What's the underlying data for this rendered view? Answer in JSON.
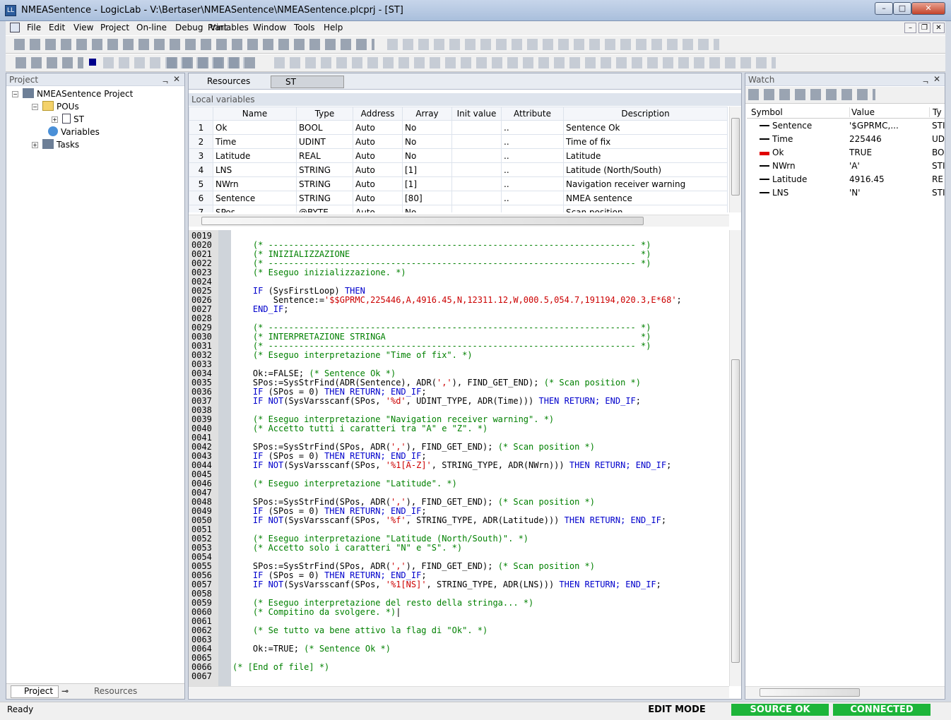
{
  "window": {
    "title": "NMEASentence - LogicLab - V:\\Bertaser\\NMEASentence\\NMEASentence.plcprj - [ST]",
    "icon": "logiclab-app-icon",
    "min": "–",
    "max": "□",
    "close": "✕"
  },
  "menu": [
    "File",
    "Edit",
    "View",
    "Project",
    "On-line",
    "Debug",
    "Print",
    "Variables",
    "Window",
    "Tools",
    "Help"
  ],
  "project_panel": {
    "title": "Project",
    "pin": "ᆨ",
    "close": "✕",
    "tree": {
      "root": "NMEASentence Project",
      "pous": "POUs",
      "st": "ST",
      "variables": "Variables",
      "tasks": "Tasks"
    },
    "tabs": [
      "Project",
      "",
      "Resources"
    ]
  },
  "editor_tabs": [
    "Resources",
    "ST"
  ],
  "locals": {
    "title": "Local variables",
    "columns": [
      "Name",
      "Type",
      "Address",
      "Array",
      "Init value",
      "Attribute",
      "Description"
    ],
    "rows": [
      [
        "1",
        "Ok",
        "BOOL",
        "Auto",
        "No",
        "",
        "..",
        "Sentence Ok"
      ],
      [
        "2",
        "Time",
        "UDINT",
        "Auto",
        "No",
        "",
        "..",
        "Time of fix"
      ],
      [
        "3",
        "Latitude",
        "REAL",
        "Auto",
        "No",
        "",
        "..",
        "Latitude"
      ],
      [
        "4",
        "LNS",
        "STRING",
        "Auto",
        "[1]",
        "",
        "..",
        "Latitude (North/South)"
      ],
      [
        "5",
        "NWrn",
        "STRING",
        "Auto",
        "[1]",
        "",
        "..",
        "Navigation receiver warning"
      ],
      [
        "6",
        "Sentence",
        "STRING",
        "Auto",
        "[80]",
        "",
        "..",
        "NMEA sentence"
      ],
      [
        "7",
        "SPos",
        "@BYTE",
        "Auto",
        "No",
        "",
        "..",
        "Scan position"
      ]
    ]
  },
  "code": {
    "line_numbers": [
      "0019",
      "0020",
      "0021",
      "0022",
      "0023",
      "0024",
      "0025",
      "0026",
      "0027",
      "0028",
      "0029",
      "0030",
      "0031",
      "0032",
      "0033",
      "0034",
      "0035",
      "0036",
      "0037",
      "0038",
      "0039",
      "0040",
      "0041",
      "0042",
      "0043",
      "0044",
      "0045",
      "0046",
      "0047",
      "0048",
      "0049",
      "0050",
      "0051",
      "0052",
      "0053",
      "0054",
      "0055",
      "0056",
      "0057",
      "0058",
      "0059",
      "0060",
      "0061",
      "0062",
      "0063",
      "0064",
      "0065",
      "0066",
      "0067"
    ],
    "lines": [
      [],
      [
        [
          "cm",
          "    (* ------------------------------------------------------------------------ *)"
        ]
      ],
      [
        [
          "cm",
          "    (* INIZIALIZZAZIONE                                                         *)"
        ]
      ],
      [
        [
          "cm",
          "    (* ------------------------------------------------------------------------ *)"
        ]
      ],
      [
        [
          "cm",
          "    (* Eseguo inizializzazione. *)"
        ]
      ],
      [],
      [
        [
          "kw",
          "    IF "
        ],
        [
          "",
          "(SysFirstLoop) "
        ],
        [
          "kw",
          "THEN"
        ]
      ],
      [
        [
          "",
          "        Sentence:="
        ],
        [
          "st",
          "'$$GPRMC,225446,A,4916.45,N,12311.12,W,000.5,054.7,191194,020.3,E*68'"
        ],
        [
          "",
          ";"
        ]
      ],
      [
        [
          "kw",
          "    END_IF"
        ],
        [
          "",
          ";"
        ]
      ],
      [],
      [
        [
          "cm",
          "    (* ------------------------------------------------------------------------ *)"
        ]
      ],
      [
        [
          "cm",
          "    (* INTERPRETAZIONE STRINGA                                                  *)"
        ]
      ],
      [
        [
          "cm",
          "    (* ------------------------------------------------------------------------ *)"
        ]
      ],
      [
        [
          "cm",
          "    (* Eseguo interpretazione \"Time of fix\". *)"
        ]
      ],
      [],
      [
        [
          "",
          "    Ok:=FALSE; "
        ],
        [
          "cm",
          "(* Sentence Ok *)"
        ]
      ],
      [
        [
          "",
          "    SPos:=SysStrFind(ADR(Sentence), ADR("
        ],
        [
          "st",
          "','"
        ],
        [
          "",
          "), FIND_GET_END); "
        ],
        [
          "cm",
          "(* Scan position *)"
        ]
      ],
      [
        [
          "kw",
          "    IF "
        ],
        [
          "",
          "(SPos = 0) "
        ],
        [
          "kw",
          "THEN RETURN; END_IF"
        ],
        [
          "",
          ";"
        ]
      ],
      [
        [
          "kw",
          "    IF NOT"
        ],
        [
          "",
          "(SysVarsscanf(SPos, "
        ],
        [
          "st",
          "'%d'"
        ],
        [
          "",
          ", UDINT_TYPE, ADR(Time))) "
        ],
        [
          "kw",
          "THEN RETURN; END_IF"
        ],
        [
          "",
          ";"
        ]
      ],
      [],
      [
        [
          "cm",
          "    (* Eseguo interpretazione \"Navigation receiver warning\". *)"
        ]
      ],
      [
        [
          "cm",
          "    (* Accetto tutti i caratteri tra \"A\" e \"Z\". *)"
        ]
      ],
      [],
      [
        [
          "",
          "    SPos:=SysStrFind(SPos, ADR("
        ],
        [
          "st",
          "','"
        ],
        [
          "",
          "), FIND_GET_END); "
        ],
        [
          "cm",
          "(* Scan position *)"
        ]
      ],
      [
        [
          "kw",
          "    IF "
        ],
        [
          "",
          "(SPos = 0) "
        ],
        [
          "kw",
          "THEN RETURN; END_IF"
        ],
        [
          "",
          ";"
        ]
      ],
      [
        [
          "kw",
          "    IF NOT"
        ],
        [
          "",
          "(SysVarsscanf(SPos, "
        ],
        [
          "st",
          "'%1[A-Z]'"
        ],
        [
          "",
          ", STRING_TYPE, ADR(NWrn))) "
        ],
        [
          "kw",
          "THEN RETURN; END_IF"
        ],
        [
          "",
          ";"
        ]
      ],
      [],
      [
        [
          "cm",
          "    (* Eseguo interpretazione \"Latitude\". *)"
        ]
      ],
      [],
      [
        [
          "",
          "    SPos:=SysStrFind(SPos, ADR("
        ],
        [
          "st",
          "','"
        ],
        [
          "",
          "), FIND_GET_END); "
        ],
        [
          "cm",
          "(* Scan position *)"
        ]
      ],
      [
        [
          "kw",
          "    IF "
        ],
        [
          "",
          "(SPos = 0) "
        ],
        [
          "kw",
          "THEN RETURN; END_IF"
        ],
        [
          "",
          ";"
        ]
      ],
      [
        [
          "kw",
          "    IF NOT"
        ],
        [
          "",
          "(SysVarsscanf(SPos, "
        ],
        [
          "st",
          "'%f'"
        ],
        [
          "",
          ", STRING_TYPE, ADR(Latitude))) "
        ],
        [
          "kw",
          "THEN RETURN; END_IF"
        ],
        [
          "",
          ";"
        ]
      ],
      [],
      [
        [
          "cm",
          "    (* Eseguo interpretazione \"Latitude (North/South)\". *)"
        ]
      ],
      [
        [
          "cm",
          "    (* Accetto solo i caratteri \"N\" e \"S\". *)"
        ]
      ],
      [],
      [
        [
          "",
          "    SPos:=SysStrFind(SPos, ADR("
        ],
        [
          "st",
          "','"
        ],
        [
          "",
          "), FIND_GET_END); "
        ],
        [
          "cm",
          "(* Scan position *)"
        ]
      ],
      [
        [
          "kw",
          "    IF "
        ],
        [
          "",
          "(SPos = 0) "
        ],
        [
          "kw",
          "THEN RETURN; END_IF"
        ],
        [
          "",
          ";"
        ]
      ],
      [
        [
          "kw",
          "    IF NOT"
        ],
        [
          "",
          "(SysVarsscanf(SPos, "
        ],
        [
          "st",
          "'%1[NS]'"
        ],
        [
          "",
          ", STRING_TYPE, ADR(LNS))) "
        ],
        [
          "kw",
          "THEN RETURN; END_IF"
        ],
        [
          "",
          ";"
        ]
      ],
      [],
      [
        [
          "cm",
          "    (* Eseguo interpretazione del resto della stringa... *)"
        ]
      ],
      [
        [
          "cm",
          "    (* Compitino da svolgere. *)"
        ],
        [
          "",
          "|"
        ]
      ],
      [],
      [
        [
          "cm",
          "    (* Se tutto va bene attivo la flag di \"Ok\". *)"
        ]
      ],
      [],
      [
        [
          "",
          "    Ok:=TRUE; "
        ],
        [
          "cm",
          "(* Sentence Ok *)"
        ]
      ],
      [],
      [
        [
          "cm",
          "(* [End of file] *)"
        ]
      ],
      []
    ]
  },
  "watch": {
    "title": "Watch",
    "pin": "ᆨ",
    "close": "✕",
    "columns": [
      "Symbol",
      "Value",
      "Ty"
    ],
    "rows": [
      {
        "symbol": "Sentence",
        "value": "'$GPRMC,...",
        "type": "STI",
        "marker": "#000000"
      },
      {
        "symbol": "Time",
        "value": "225446",
        "type": "UD",
        "marker": "#000000"
      },
      {
        "symbol": "Ok",
        "value": "TRUE",
        "type": "BO",
        "marker": "#e00000"
      },
      {
        "symbol": "NWrn",
        "value": "'A'",
        "type": "STI",
        "marker": "#000000"
      },
      {
        "symbol": "Latitude",
        "value": "4916.45",
        "type": "RE",
        "marker": "#000000"
      },
      {
        "symbol": "LNS",
        "value": "'N'",
        "type": "STI",
        "marker": "#000000"
      }
    ]
  },
  "status": {
    "left": "Ready",
    "mode": "EDIT MODE",
    "source": "SOURCE OK",
    "conn": "CONNECTED",
    "ok_color": "#1db53a"
  }
}
